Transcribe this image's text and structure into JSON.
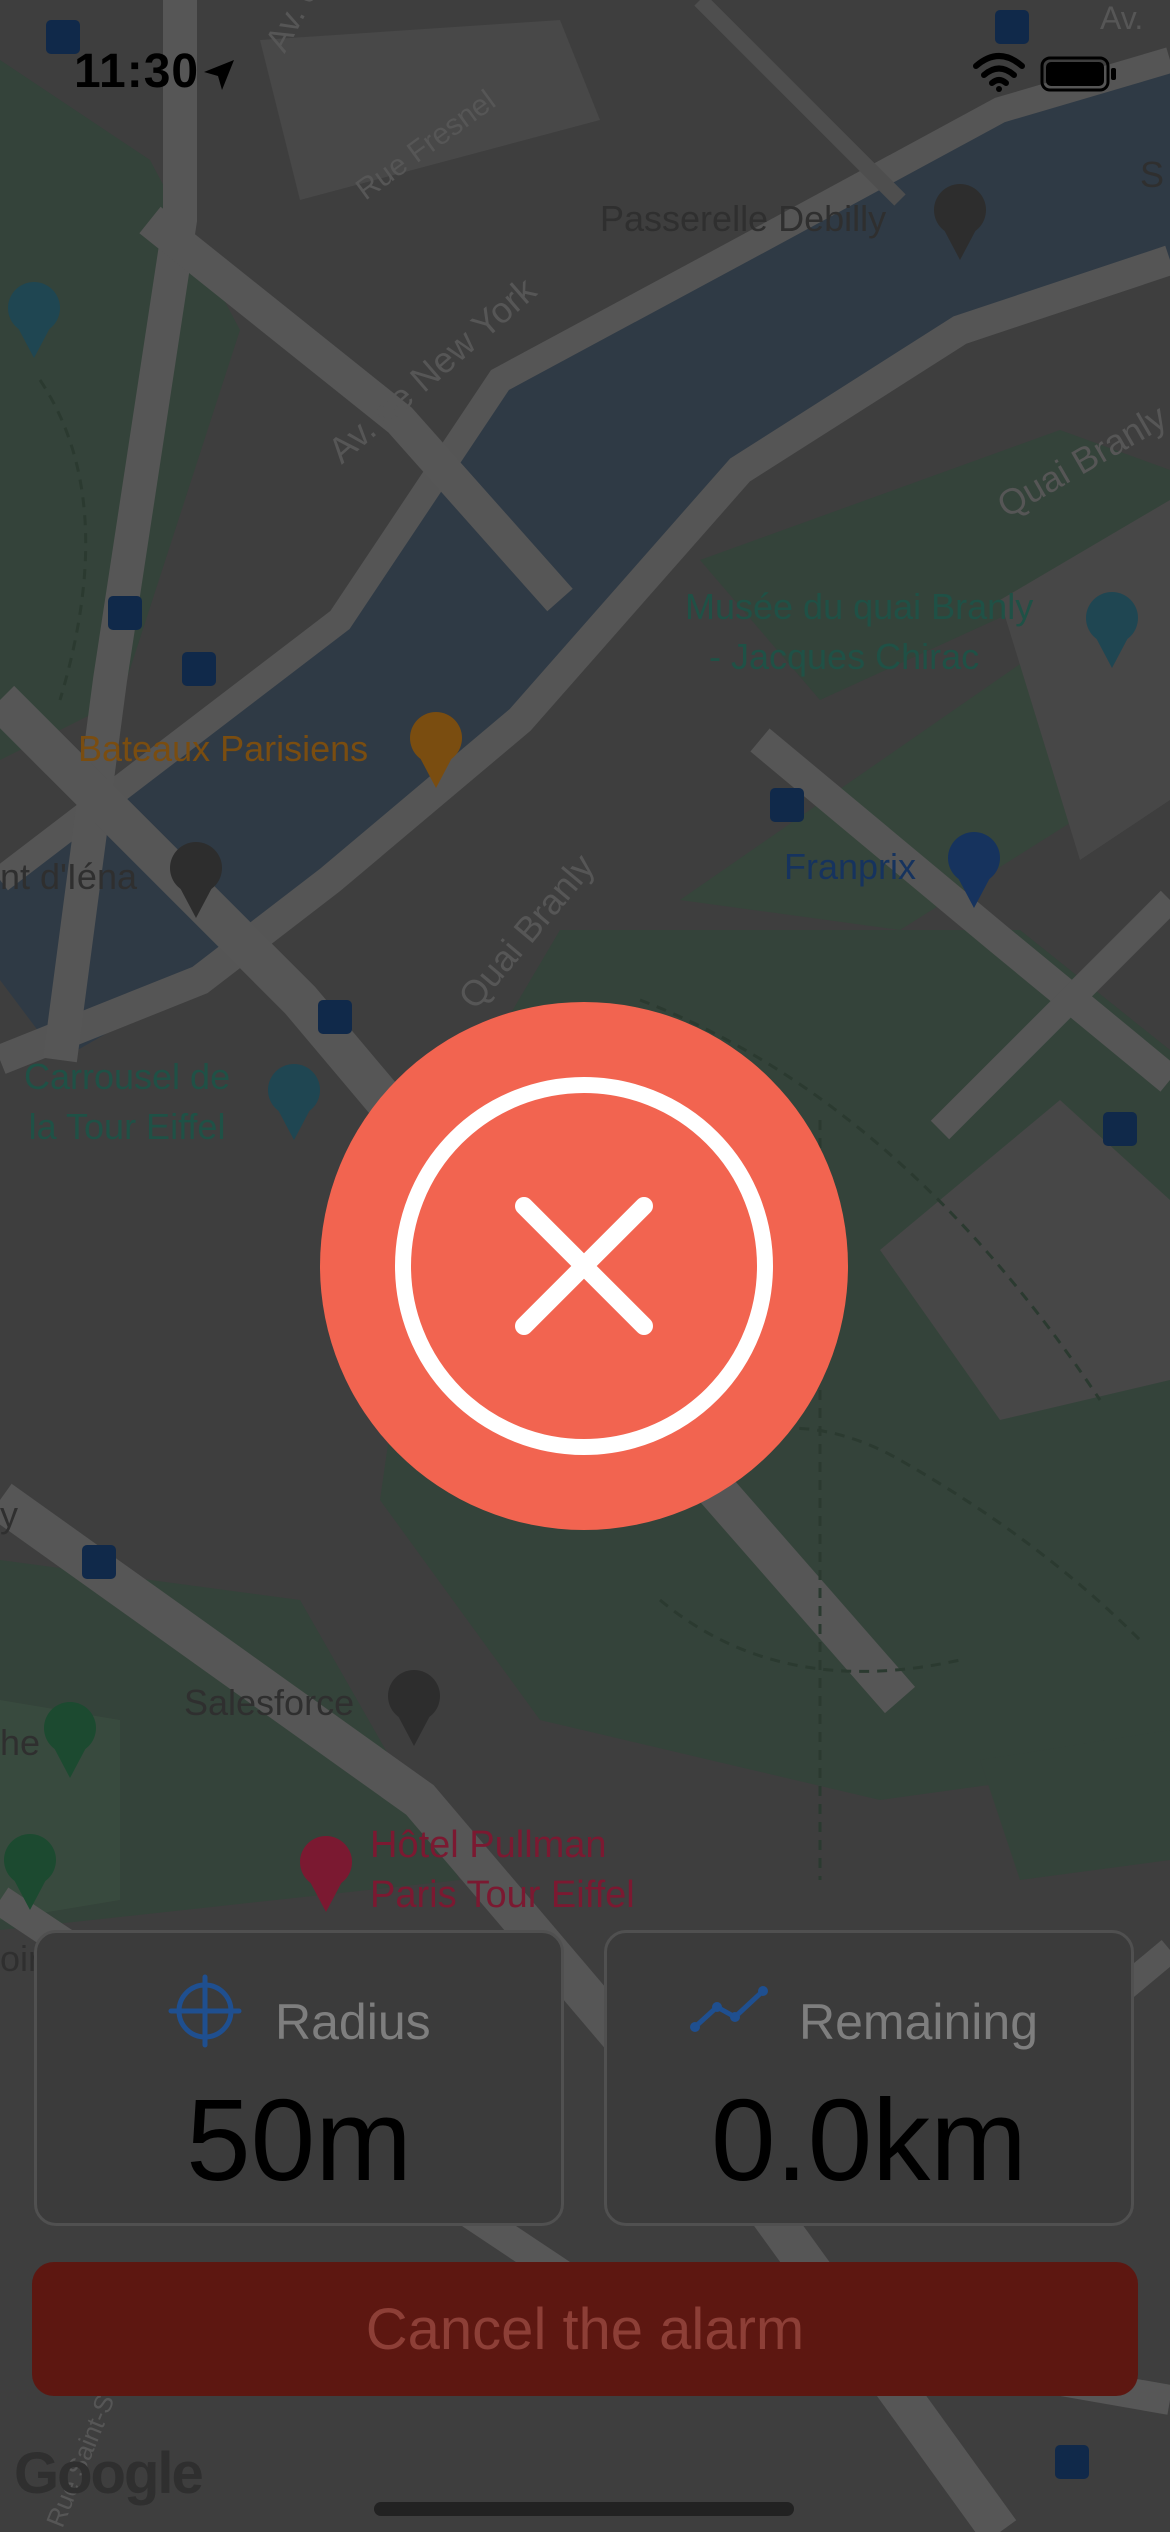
{
  "status_bar": {
    "time": "11:30"
  },
  "map": {
    "street_labels": {
      "av_iena": "Av. d'Iéna",
      "av_top_right": "Av.",
      "rue_fresnel": "Rue Fresnel",
      "av_new_york": "Av. de New York",
      "quai_branly_upper": "Quai Branly",
      "quai_branly_lower": "Quai Branly",
      "rue_saint": "Rue Saint-S"
    },
    "poi_labels": {
      "passerelle": "Passerelle Debilly",
      "musee_line1": "Musée du quai Branly",
      "musee_line2": "- Jacques Chirac",
      "bateaux": "Bateaux Parisiens",
      "pont_iena": "nt d'Iéna",
      "franprix": "Franprix",
      "carrousel_line1": "Carrousel de",
      "carrousel_line2": "la Tour Eiffel",
      "salesforce": "Salesforce",
      "hotel_line1": "Hôtel Pullman",
      "hotel_line2": "Paris Tour Eiffel",
      "edge_he": "he",
      "edge_oir": "oir",
      "edge_y": "y",
      "edge_s": "S"
    },
    "attribution": "Google"
  },
  "status_overlay": {
    "icon": "close-circle-icon",
    "color": "#f26450"
  },
  "stats": {
    "radius": {
      "label": "Radius",
      "value": "50m",
      "icon": "crosshair-icon"
    },
    "remaining": {
      "label": "Remaining",
      "value": "0.0km",
      "icon": "trend-line-icon"
    }
  },
  "actions": {
    "cancel_label": "Cancel the alarm",
    "cancel_color": "#5d1711"
  },
  "colors": {
    "accent_blue": "#1f4f8f",
    "alert_red": "#f26450"
  }
}
